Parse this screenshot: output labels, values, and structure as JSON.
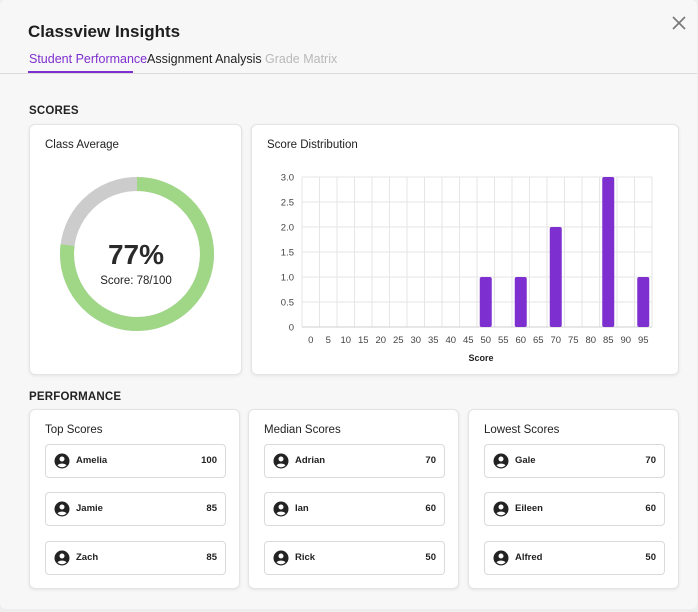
{
  "header": {
    "title": "Classview Insights",
    "tabs": [
      {
        "label": "Student Performance",
        "state": "active"
      },
      {
        "label": "Assignment Analysis",
        "state": "normal"
      },
      {
        "label": "Grade Matrix",
        "state": "disabled"
      }
    ]
  },
  "colors": {
    "accent": "#7e2fd0",
    "donut_fill": "#9fd787",
    "donut_rest": "#cccccc",
    "bar": "#7e2fd0"
  },
  "scores_section": {
    "label": "SCORES"
  },
  "class_average": {
    "title": "Class Average",
    "percent_label": "77%",
    "score_label": "Score: 78/100",
    "fraction": 0.77
  },
  "distribution": {
    "title": "Score Distribution"
  },
  "chart_data": {
    "type": "bar",
    "title": "Score Distribution",
    "xlabel": "Score",
    "ylabel": "",
    "categories": [
      "0",
      "5",
      "10",
      "15",
      "20",
      "25",
      "30",
      "35",
      "40",
      "45",
      "50",
      "55",
      "60",
      "65",
      "70",
      "75",
      "80",
      "85",
      "90",
      "95"
    ],
    "values": [
      0,
      0,
      0,
      0,
      0,
      0,
      0,
      0,
      0,
      0,
      1,
      0,
      1,
      0,
      2,
      0,
      0,
      3,
      0,
      1
    ],
    "y_ticks": [
      "0",
      "0.5",
      "1.0",
      "1.5",
      "2.0",
      "2.5",
      "3.0"
    ],
    "ylim": [
      0,
      3
    ],
    "grid": true
  },
  "performance_section": {
    "label": "PERFORMANCE"
  },
  "groups": [
    {
      "title": "Top Scores",
      "students": [
        {
          "name": "Amelia",
          "score": "100"
        },
        {
          "name": "Jamie",
          "score": "85"
        },
        {
          "name": "Zach",
          "score": "85"
        }
      ]
    },
    {
      "title": "Median Scores",
      "students": [
        {
          "name": "Adrian",
          "score": "70"
        },
        {
          "name": "Ian",
          "score": "60"
        },
        {
          "name": "Rick",
          "score": "50"
        }
      ]
    },
    {
      "title": "Lowest Scores",
      "students": [
        {
          "name": "Gale",
          "score": "70"
        },
        {
          "name": "Eileen",
          "score": "60"
        },
        {
          "name": "Alfred",
          "score": "50"
        }
      ]
    }
  ]
}
